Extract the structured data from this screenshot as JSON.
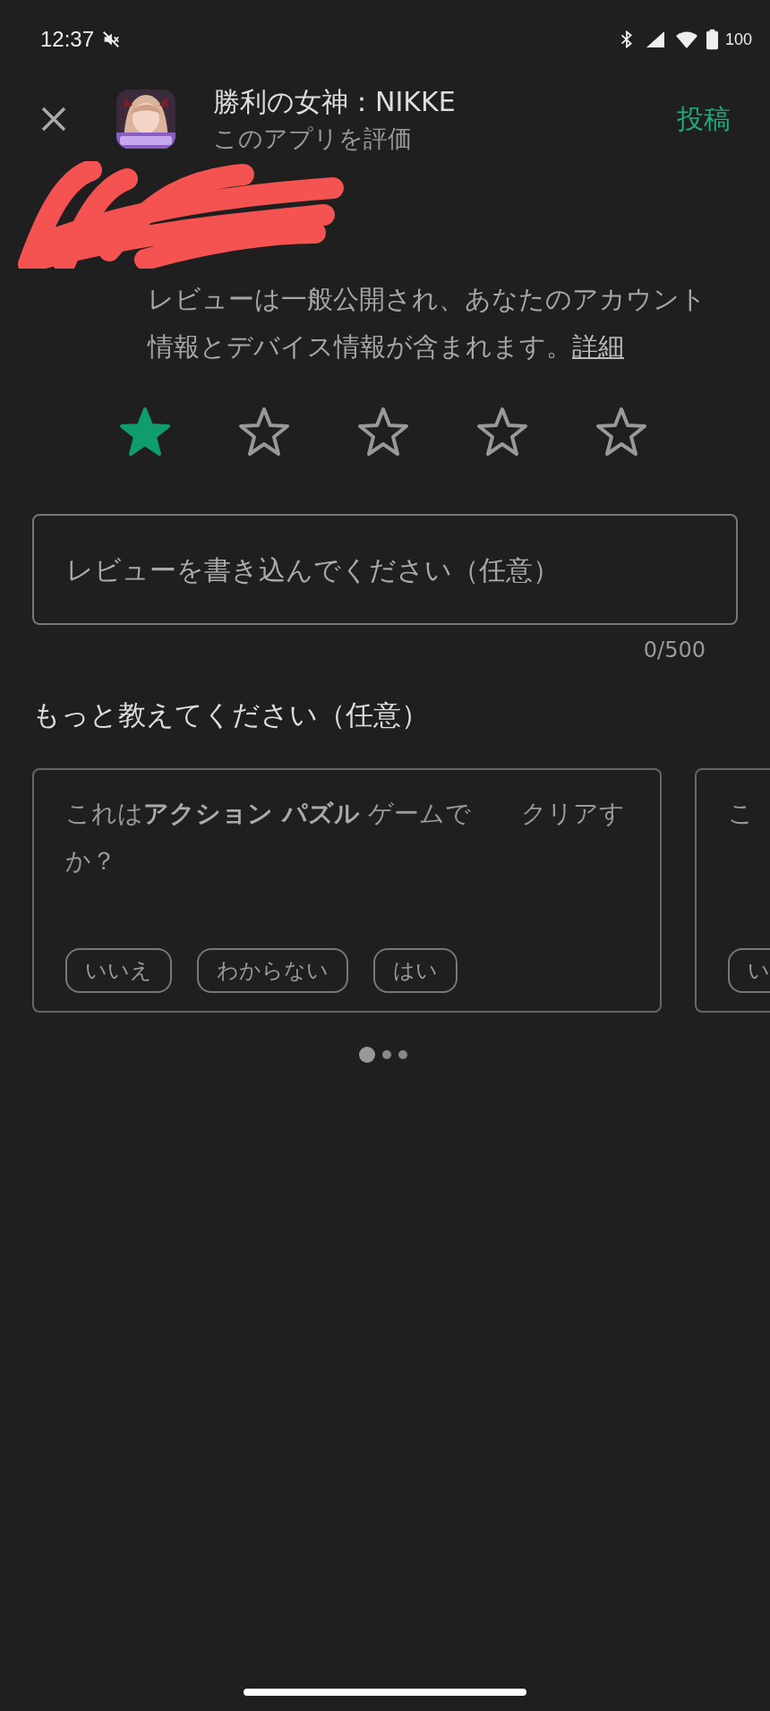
{
  "status_bar": {
    "time": "12:37",
    "battery": "100"
  },
  "header": {
    "title": "勝利の女神：NIKKE",
    "subtitle": "このアプリを評価",
    "post_button": "投稿"
  },
  "notice": {
    "text": "レビューは一般公開され、あなたのアカウント情報とデバイス情報が含まれます。",
    "link": "詳細"
  },
  "rating": {
    "stars": 1
  },
  "review_field": {
    "placeholder": "レビューを書き込んでください（任意）",
    "counter": "0/500"
  },
  "feedback": {
    "heading": "もっと教えてください（任意）",
    "cards": [
      {
        "question": "これは**アクション パズル** ゲームで　　クリアすか？",
        "options": [
          "いいえ",
          "わからない",
          "はい"
        ]
      },
      {
        "question": "こ",
        "options": [
          "い"
        ]
      }
    ],
    "pager": [
      {
        "selected": true
      },
      {
        "selected": false
      },
      {
        "selected": false
      }
    ]
  }
}
